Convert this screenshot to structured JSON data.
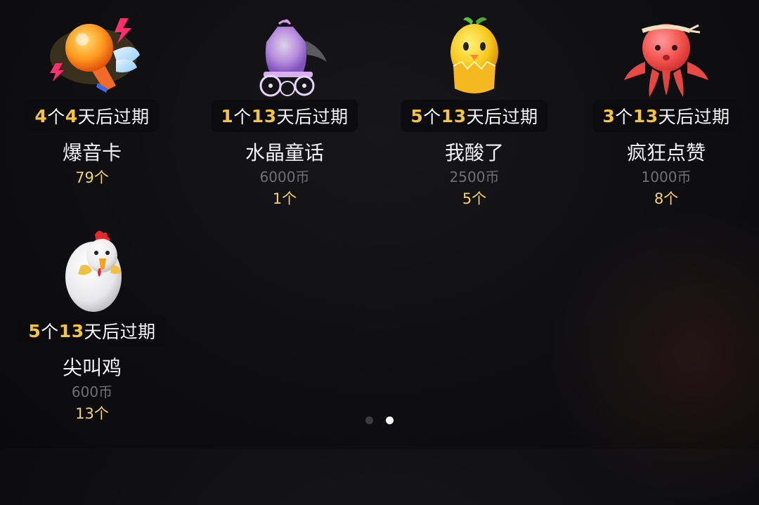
{
  "gifts": [
    {
      "badge_num": "4",
      "badge_unit": "个",
      "badge_days": "4",
      "badge_suffix": "天后过期",
      "name": "爆音卡",
      "price": "",
      "count": "79个",
      "icon": "microphone-icon"
    },
    {
      "badge_num": "1",
      "badge_unit": "个",
      "badge_days": "13",
      "badge_suffix": "天后过期",
      "name": "水晶童话",
      "price": "6000币",
      "count": "1个",
      "icon": "carriage-icon"
    },
    {
      "badge_num": "5",
      "badge_unit": "个",
      "badge_days": "13",
      "badge_suffix": "天后过期",
      "name": "我酸了",
      "price": "2500币",
      "count": "5个",
      "icon": "lemon-chick-icon"
    },
    {
      "badge_num": "3",
      "badge_unit": "个",
      "badge_days": "13",
      "badge_suffix": "天后过期",
      "name": "疯狂点赞",
      "price": "1000币",
      "count": "8个",
      "icon": "octopus-icon"
    },
    {
      "badge_num": "5",
      "badge_unit": "个",
      "badge_days": "13",
      "badge_suffix": "天后过期",
      "name": "尖叫鸡",
      "price": "600币",
      "count": "13个",
      "icon": "rooster-icon"
    }
  ],
  "pager": {
    "pages": 2,
    "active_index": 1
  },
  "colors": {
    "accent_yellow": "#f6c43b",
    "count_yellow": "#f3d46a",
    "price_gray": "#6f6f75",
    "background": "#0f0f12"
  }
}
